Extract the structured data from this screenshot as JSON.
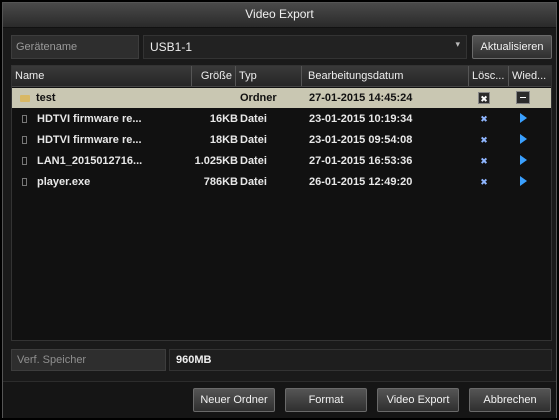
{
  "title": "Video Export",
  "device": {
    "label": "Gerätename",
    "value": "USB1-1",
    "refresh_label": "Aktualisieren"
  },
  "columns": {
    "name": "Name",
    "size": "Größe",
    "type": "Typ",
    "date": "Bearbeitungsdatum",
    "delete": "Lösc...",
    "play": "Wied..."
  },
  "rows": [
    {
      "name": "test",
      "size": "",
      "type": "Ordner",
      "date": "27-01-2015 14:45:24",
      "kind": "folder"
    },
    {
      "name": "HDTVI firmware re...",
      "size": "16KB",
      "type": "Datei",
      "date": "23-01-2015 10:19:34",
      "kind": "file"
    },
    {
      "name": "HDTVI firmware re...",
      "size": "18KB",
      "type": "Datei",
      "date": "23-01-2015 09:54:08",
      "kind": "file"
    },
    {
      "name": "LAN1_2015012716...",
      "size": "1.025KB",
      "type": "Datei",
      "date": "27-01-2015 16:53:36",
      "kind": "file"
    },
    {
      "name": "player.exe",
      "size": "786KB",
      "type": "Datei",
      "date": "26-01-2015 12:49:20",
      "kind": "file"
    }
  ],
  "memory": {
    "label": "Verf. Speicher",
    "value": "960MB"
  },
  "buttons": {
    "new_folder": "Neuer Ordner",
    "format": "Format",
    "export": "Video Export",
    "cancel": "Abbrechen"
  },
  "icons": {
    "folder": "folder-icon",
    "file": "file-icon",
    "delete": "delete-icon",
    "play": "play-icon",
    "dropdown": "chevron-down-icon"
  },
  "colors": {
    "selected_row": "#c9c7b2",
    "play_accent": "#3aa0ff",
    "folder": "#d8b865"
  }
}
